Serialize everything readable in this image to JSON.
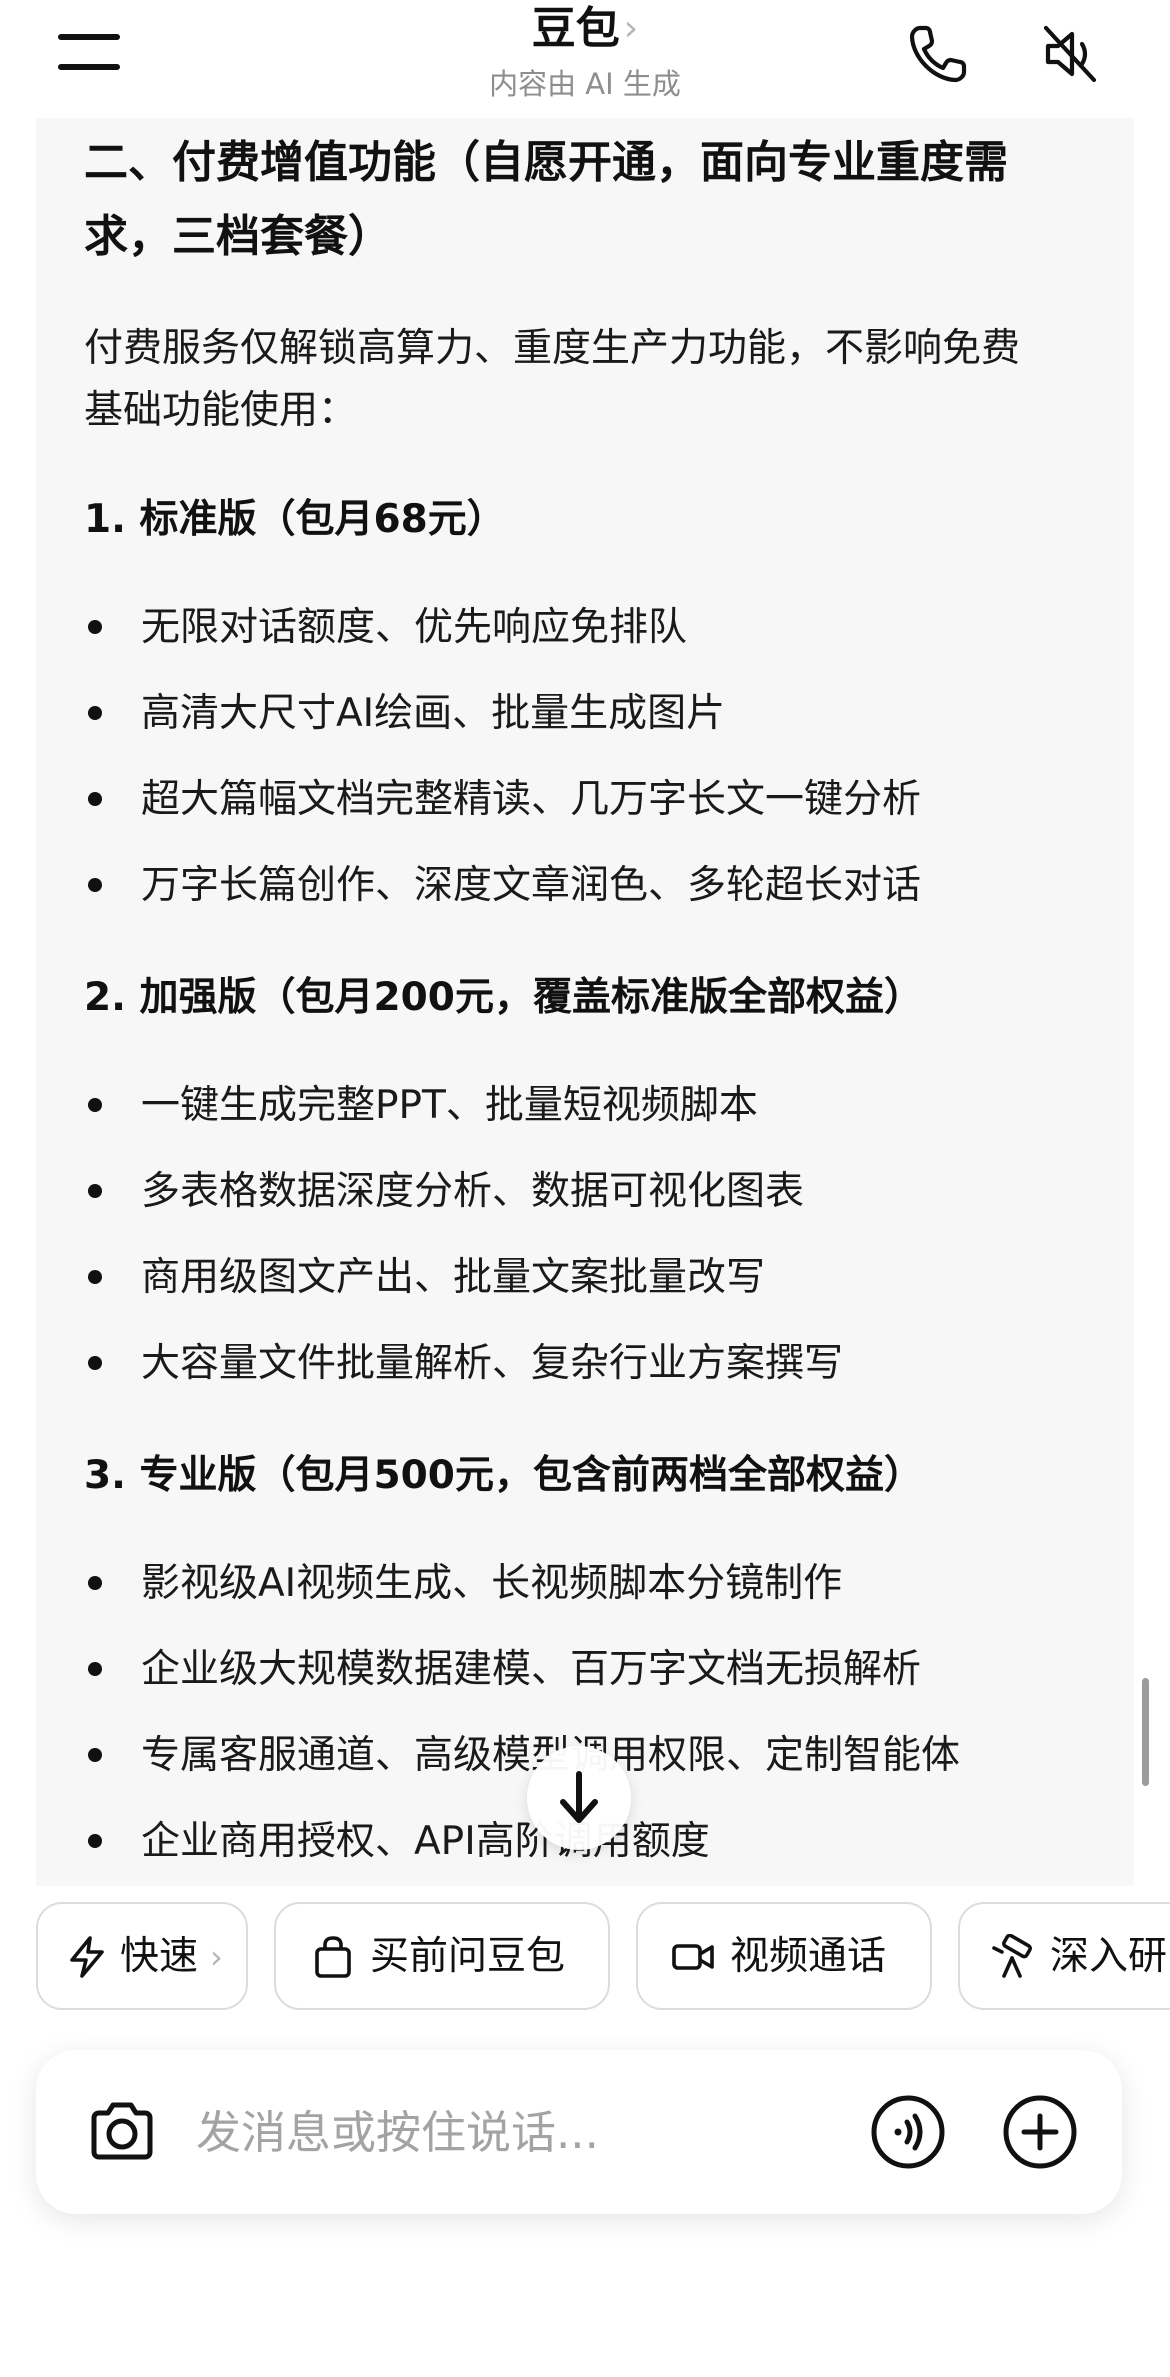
{
  "header": {
    "title": "豆包",
    "title_chevron": "›",
    "subtitle": "内容由 AI 生成"
  },
  "content": {
    "heading_line1": "二、付费增值功能（自愿开通，面向专业重度需",
    "heading_line2": "求，三档套餐）",
    "intro_line1": "付费服务仅解锁高算力、重度生产力功能，不影响免费",
    "intro_line2": "基础功能使用：",
    "plans": [
      {
        "title": "1. 标准版（包月68元）",
        "items": [
          "无限对话额度、优先响应免排队",
          "高清大尺寸AI绘画、批量生成图片",
          "超大篇幅文档完整精读、几万字长文一键分析",
          "万字长篇创作、深度文章润色、多轮超长对话"
        ]
      },
      {
        "title": "2. 加强版（包月200元，覆盖标准版全部权益）",
        "items": [
          "一键生成完整PPT、批量短视频脚本",
          "多表格数据深度分析、数据可视化图表",
          "商用级图文产出、批量文案批量改写",
          "大容量文件批量解析、复杂行业方案撰写"
        ]
      },
      {
        "title": "3. 专业版（包月500元，包含前两档全部权益）",
        "items": [
          "影视级AI视频生成、长视频脚本分镜制作",
          "企业级大规模数据建模、百万字文档无损解析",
          "专属客服通道、高级模型调用权限、定制智能体",
          "企业商用授权、API高阶调用额度"
        ]
      }
    ]
  },
  "chips": {
    "fast": "快速",
    "fast_chevron": "›",
    "ask_before_buy": "买前问豆包",
    "video_call": "视频通话",
    "deep_research": "深入研"
  },
  "input": {
    "placeholder": "发消息或按住说话..."
  },
  "icons": {
    "menu": "hamburger-menu-icon",
    "phone": "phone-icon",
    "mute": "speaker-muted-icon",
    "scroll_down": "arrow-down-icon",
    "lightning": "lightning-icon",
    "shopping_bag": "shopping-bag-icon",
    "video": "video-camera-icon",
    "telescope": "telescope-icon",
    "camera": "camera-icon",
    "voice": "voice-wave-icon",
    "plus": "plus-circle-icon"
  },
  "colors": {
    "card_background": "#f7f7f8",
    "text": "#111111",
    "muted": "#8e8e8e",
    "placeholder": "#a3a3a3"
  }
}
